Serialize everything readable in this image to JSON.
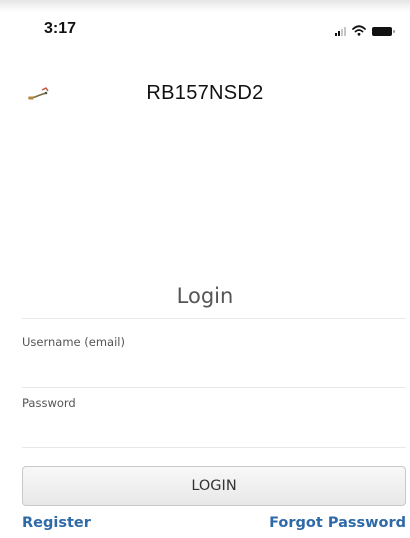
{
  "status_bar": {
    "time": "3:17",
    "icons": [
      "cellular-signal-icon",
      "wifi-icon",
      "battery-icon"
    ]
  },
  "header": {
    "logo_icon": "device-logo-icon",
    "device_name": "RB157NSD2"
  },
  "login": {
    "heading": "Login",
    "username_label": "Username (email)",
    "username_value": "",
    "password_label": "Password",
    "password_value": "",
    "button_label": "LOGIN",
    "register_link": "Register",
    "forgot_password_link": "Forgot Password"
  },
  "colors": {
    "link": "#2f6aa8",
    "button_background": "#efefef",
    "heading_text": "#555555"
  }
}
